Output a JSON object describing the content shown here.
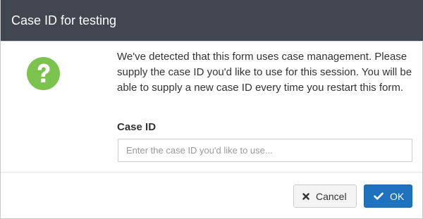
{
  "dialog": {
    "title": "Case ID for testing",
    "message": "We've detected that this form uses case management. Please supply the case ID you'd like to use for this session. You will be able to supply a new case ID every time you restart this form.",
    "field_label": "Case ID",
    "input": {
      "value": "",
      "placeholder": "Enter the case ID you'd like to use..."
    },
    "buttons": {
      "cancel_label": "Cancel",
      "ok_label": "OK"
    },
    "icons": {
      "help": "question-circle-icon",
      "cancel": "close-icon",
      "ok": "checkmark-icon"
    },
    "colors": {
      "titlebar": "#424650",
      "help_icon": "#7bc24e",
      "primary_button": "#1f72bd"
    }
  }
}
